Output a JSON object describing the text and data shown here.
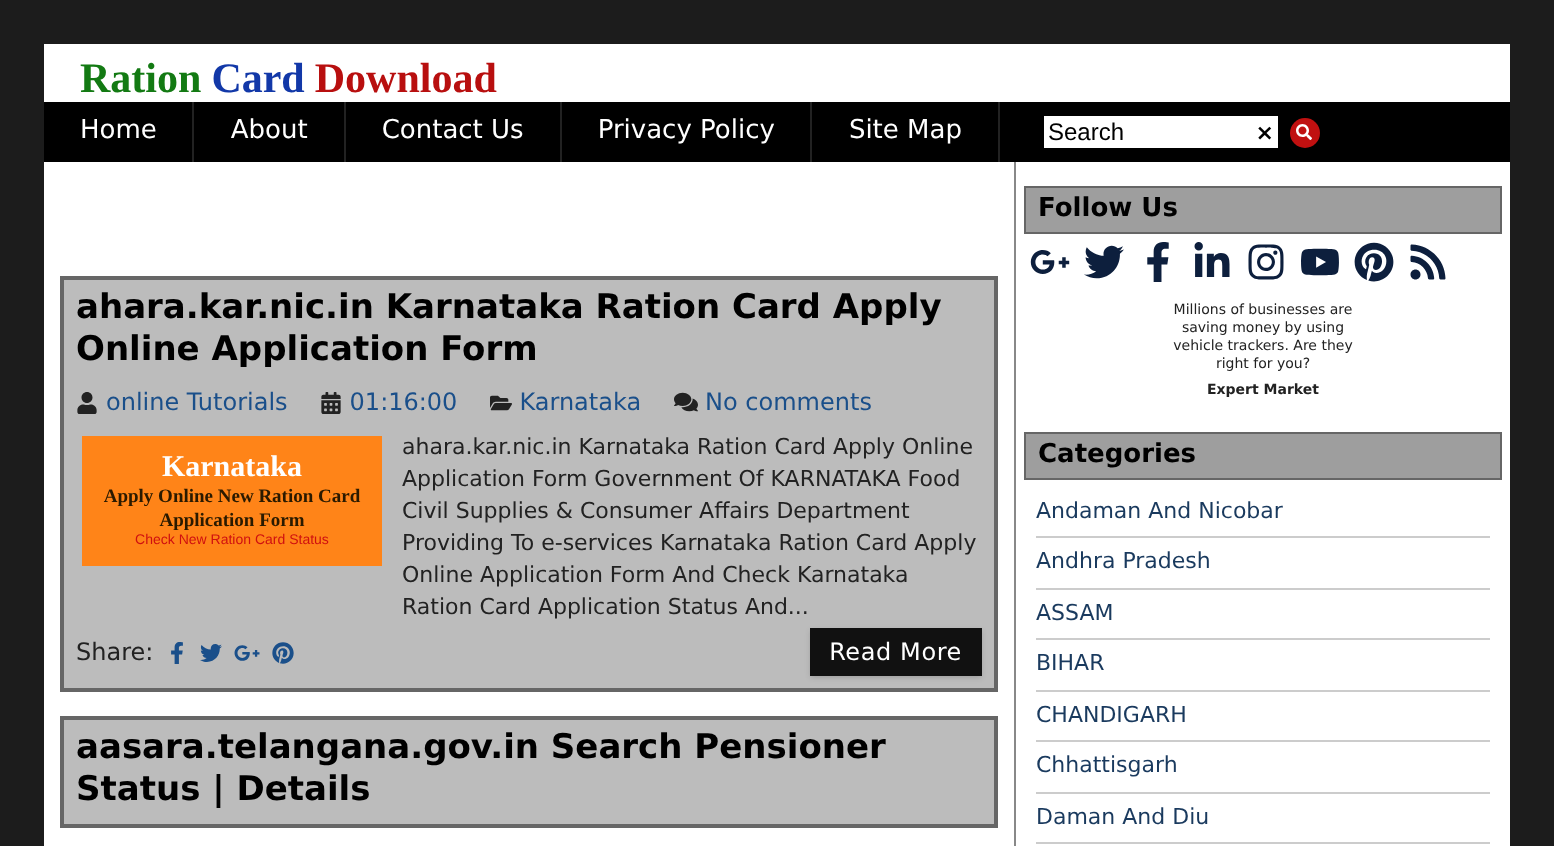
{
  "logo": [
    {
      "text": "Ration",
      "color": "#137a13"
    },
    {
      "text": "Card",
      "color": "#1238a8"
    },
    {
      "text": "Download",
      "color": "#b80f0f"
    }
  ],
  "nav": [
    "Home",
    "About",
    "Contact Us",
    "Privacy Policy",
    "Site Map"
  ],
  "search": {
    "placeholder": "Search",
    "clear": "×"
  },
  "posts": [
    {
      "title": "ahara.kar.nic.in Karnataka Ration Card Apply Online Application Form",
      "author": "online Tutorials",
      "time": "01:16:00",
      "category": "Karnataka",
      "comments": "No comments",
      "thumbnail": {
        "heading": "Karnataka",
        "subtitle": "Apply Online New Ration Card Application Form",
        "note": "Check New Ration Card Status"
      },
      "excerpt": "ahara.kar.nic.in Karnataka Ration Card Apply Online Application Form Government Of KARNATAKA Food Civil Supplies & Consumer Affairs Department Providing To e-services Karnataka Ration Card Apply Online Application Form And Check Karnataka Ration Card Application Status And...",
      "share_label": "Share:",
      "read_more": "Read More"
    },
    {
      "title": "aasara.telangana.gov.in Search Pensioner Status | Details"
    }
  ],
  "sidebar": {
    "follow_title": "Follow Us",
    "ad": {
      "text": "Millions of businesses are saving money by using vehicle trackers. Are they right for you?",
      "brand": "Expert Market"
    },
    "categories_title": "Categories",
    "categories": [
      "Andaman And Nicobar",
      "Andhra Pradesh",
      "ASSAM",
      "BIHAR",
      "CHANDIGARH",
      "Chhattisgarh",
      "Daman And Diu"
    ]
  }
}
